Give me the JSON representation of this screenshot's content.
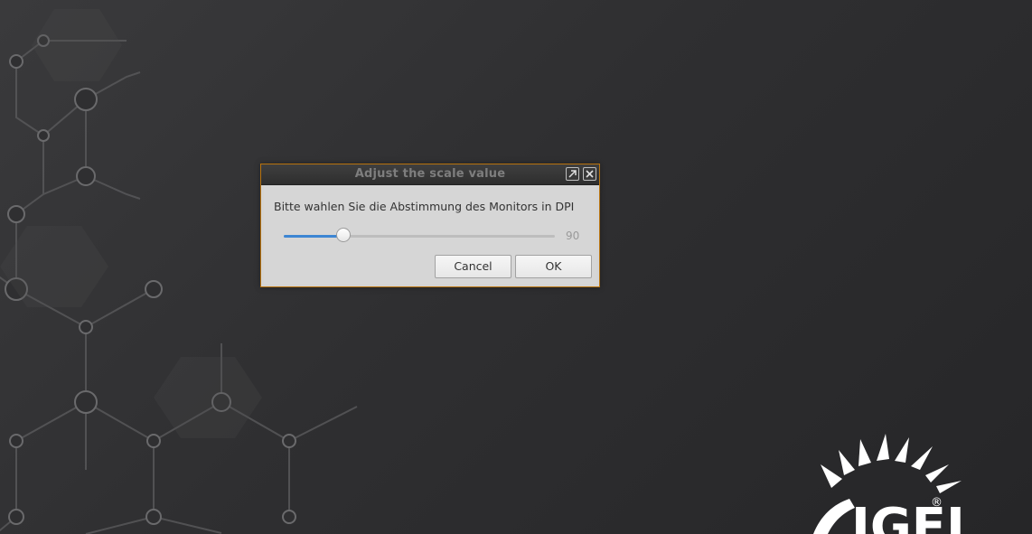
{
  "dialog": {
    "title": "Adjust the scale value",
    "prompt": "Bitte wahlen Sie die Abstimmung des Monitors in DPI",
    "slider": {
      "value": "90",
      "fraction": 0.22,
      "accent": "#3d86d3"
    },
    "buttons": {
      "cancel": "Cancel",
      "ok": "OK"
    },
    "border_color": "#b8730e",
    "icons": {
      "maximize": "maximize-icon",
      "close": "close-icon"
    }
  },
  "logo": {
    "text": "IGEL",
    "mark": "®"
  }
}
